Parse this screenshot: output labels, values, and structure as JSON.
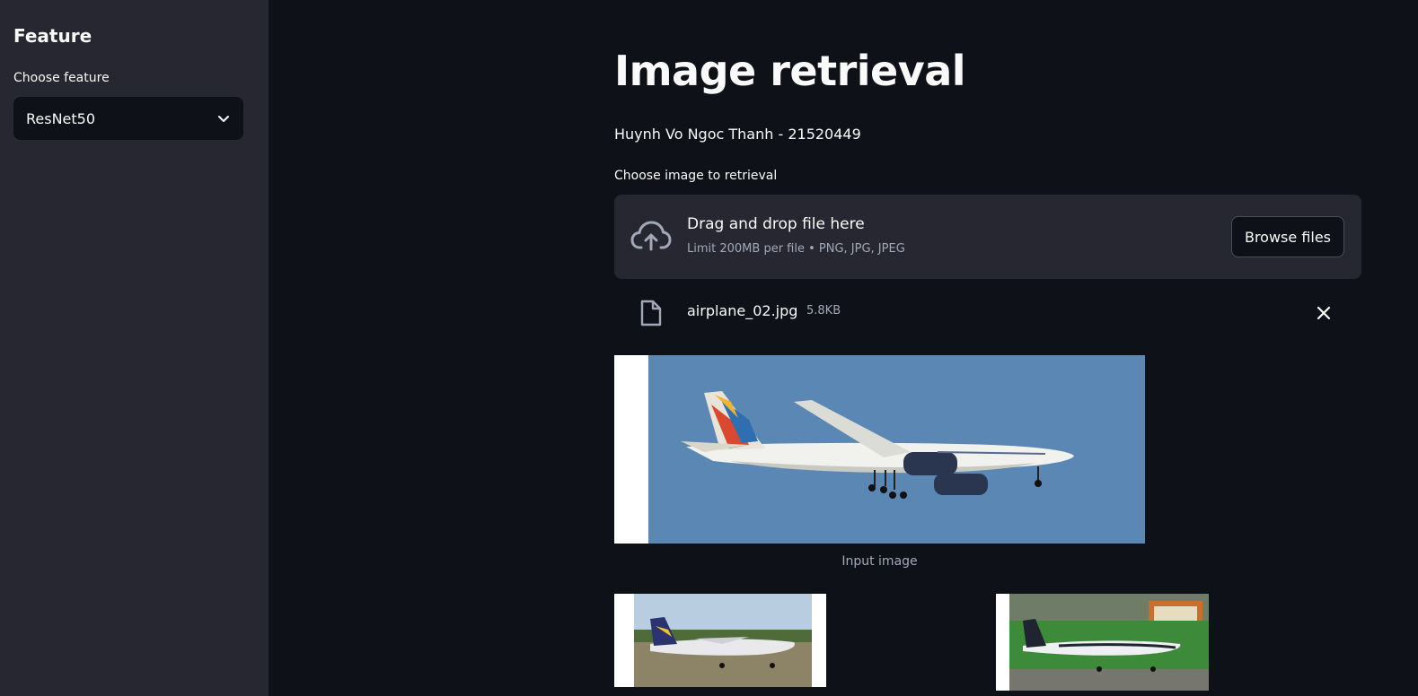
{
  "sidebar": {
    "title": "Feature",
    "select_label": "Choose feature",
    "select_value": "ResNet50"
  },
  "main": {
    "title": "Image retrieval",
    "author": "Huynh Vo Ngoc Thanh - 21520449",
    "uploader": {
      "label": "Choose image to retrieval",
      "drop_title": "Drag and drop file here",
      "drop_limit": "Limit 200MB per file • PNG, JPG, JPEG",
      "browse_label": "Browse files"
    },
    "file": {
      "name": "airplane_02.jpg",
      "size": "5.8KB"
    },
    "input_caption": "Input image"
  },
  "icons": {
    "chevron": "chevron-down-icon",
    "upload": "cloud-upload-icon",
    "file": "file-icon",
    "close": "close-icon"
  },
  "colors": {
    "background": "#0e1117",
    "sidebar": "#262730",
    "text": "#fafafa",
    "muted_text": "#a3a8b8"
  }
}
